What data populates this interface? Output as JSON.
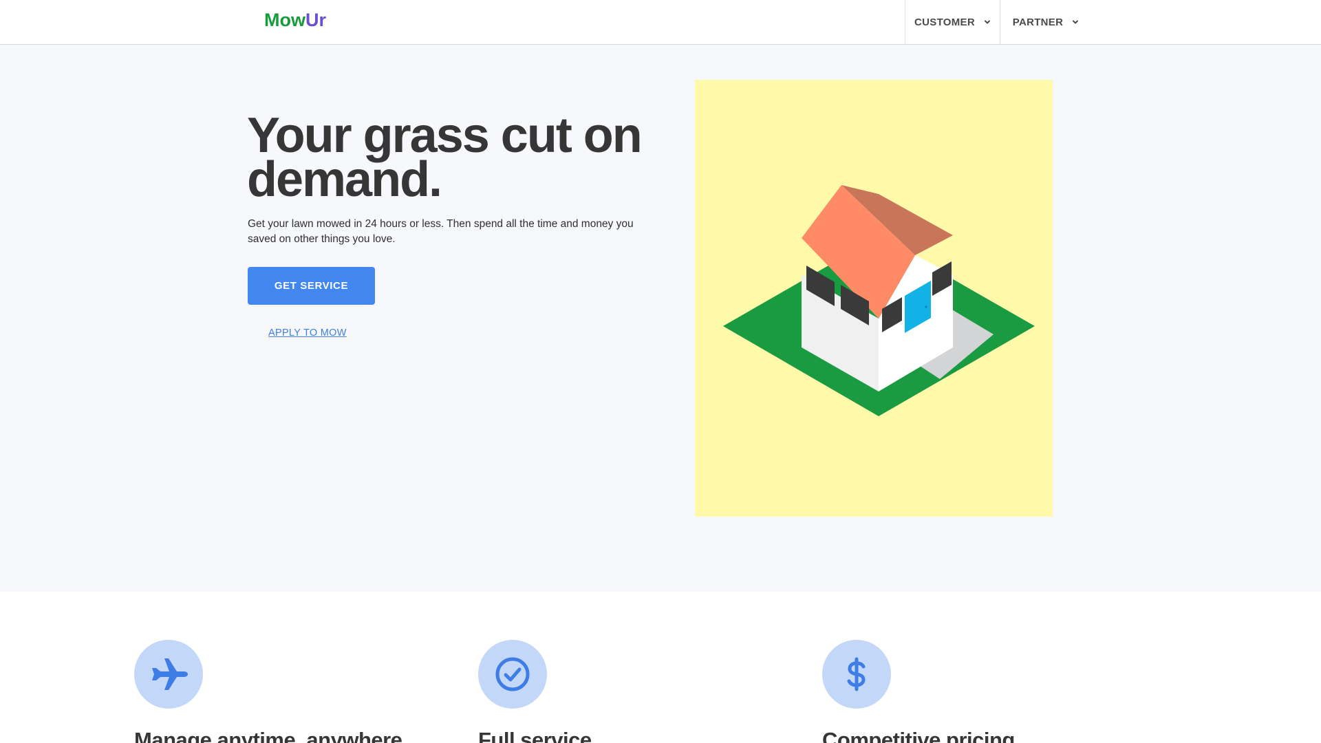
{
  "brand": {
    "logo_part1": "Mow",
    "logo_part2": "Ur",
    "color_part1": "#179b3b",
    "color_part2": "#6a4fd0"
  },
  "nav": {
    "items": [
      {
        "label": "CUSTOMER",
        "icon": "chevron-down-icon"
      },
      {
        "label": "PARTNER",
        "icon": "chevron-down-icon"
      }
    ]
  },
  "hero": {
    "title": "Your grass cut on demand.",
    "subtitle": "Get your lawn mowed in 24 hours or less. Then spend all the time and money you saved on other things you love.",
    "primary_button": "GET SERVICE",
    "secondary_link": "APPLY TO MOW",
    "accent_color": "#4287f0",
    "illustration_icon": "isometric-house-icon"
  },
  "features": [
    {
      "title": "Manage anytime, anywhere",
      "icon": "airplane-icon"
    },
    {
      "title": "Full service",
      "icon": "check-circle-icon"
    },
    {
      "title": "Competitive pricing",
      "icon": "dollar-icon"
    }
  ]
}
